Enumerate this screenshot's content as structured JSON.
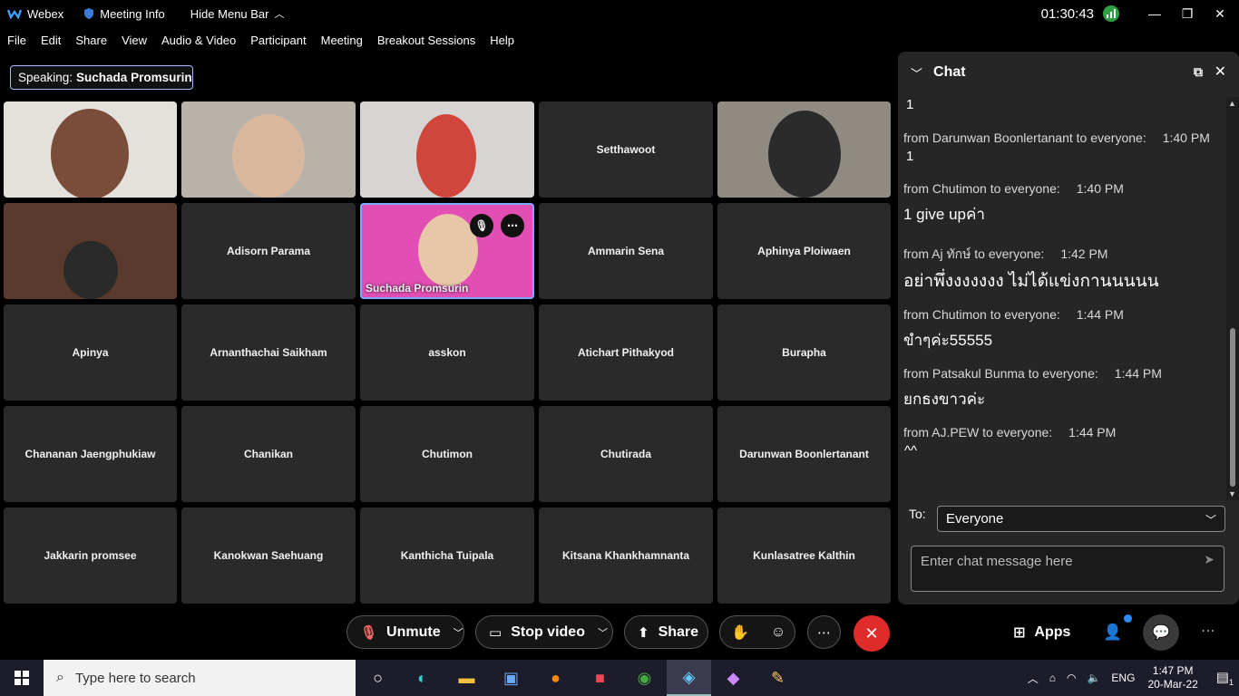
{
  "titlebar": {
    "app_name": "Webex",
    "meeting_info": "Meeting Info",
    "hide_menu_bar": "Hide Menu Bar",
    "timer": "01:30:43"
  },
  "menu": [
    "File",
    "Edit",
    "Share",
    "View",
    "Audio & Video",
    "Participant",
    "Meeting",
    "Breakout Sessions",
    "Help"
  ],
  "speaking": {
    "label": "Speaking:",
    "name": "Suchada Promsurin"
  },
  "tiles": [
    {
      "name": "",
      "video": true
    },
    {
      "name": "",
      "video": true
    },
    {
      "name": "",
      "video": true
    },
    {
      "name": "Setthawoot",
      "video": false
    },
    {
      "name": "",
      "video": true
    },
    {
      "name": "",
      "video": true
    },
    {
      "name": "Adisorn Parama",
      "video": false
    },
    {
      "name": "Suchada Promsurin",
      "video": true,
      "active": true
    },
    {
      "name": "Ammarin Sena",
      "video": false
    },
    {
      "name": "Aphinya Ploiwaen",
      "video": false
    },
    {
      "name": "Apinya",
      "video": false
    },
    {
      "name": "Arnanthachai Saikham",
      "video": false
    },
    {
      "name": "asskon",
      "video": false
    },
    {
      "name": "Atichart Pithakyod",
      "video": false
    },
    {
      "name": "Burapha",
      "video": false
    },
    {
      "name": "Chananan Jaengphukiaw",
      "video": false
    },
    {
      "name": "Chanikan",
      "video": false
    },
    {
      "name": "Chutimon",
      "video": false
    },
    {
      "name": "Chutirada",
      "video": false
    },
    {
      "name": "Darunwan Boonlertanant",
      "video": false
    },
    {
      "name": "Jakkarin promsee",
      "video": false
    },
    {
      "name": "Kanokwan Saehuang",
      "video": false
    },
    {
      "name": "Kanthicha Tuipala",
      "video": false
    },
    {
      "name": "Kitsana Khankhamnanta",
      "video": false
    },
    {
      "name": "Kunlasatree Kalthin",
      "video": false
    }
  ],
  "chat": {
    "title": "Chat",
    "first_line": "1",
    "messages": [
      {
        "from": "from Darunwan Boonlertanant to everyone:",
        "time": "1:40 PM",
        "text": "1"
      },
      {
        "from": "from Chutimon to everyone:",
        "time": "1:40 PM",
        "text": "1 give upค่า"
      },
      {
        "from": "from Aj ทักษ์ to everyone:",
        "time": "1:42 PM",
        "text": "อย่าพึ่งงงงงงง ไม่ได้แข่งกานนนนน"
      },
      {
        "from": "from Chutimon to everyone:",
        "time": "1:44 PM",
        "text": "ขำๆค่ะ55555"
      },
      {
        "from": "from Patsakul Bunma to everyone:",
        "time": "1:44 PM",
        "text": "ยกธงขาวค่ะ"
      },
      {
        "from": "from AJ.PEW to everyone:",
        "time": "1:44 PM",
        "text": "^^"
      }
    ],
    "to_label": "To:",
    "to_value": "Everyone",
    "input_placeholder": "Enter chat message here"
  },
  "controls": {
    "unmute": "Unmute",
    "stop_video": "Stop video",
    "share": "Share",
    "apps": "Apps"
  },
  "taskbar": {
    "search_placeholder": "Type here to search",
    "lang": "ENG",
    "time": "1:47 PM",
    "date": "20-Mar-22",
    "notifications": "1"
  },
  "colors": {
    "end_call": "#e02b2b",
    "active_border": "#7ea8ff",
    "signal": "#2ea043"
  }
}
